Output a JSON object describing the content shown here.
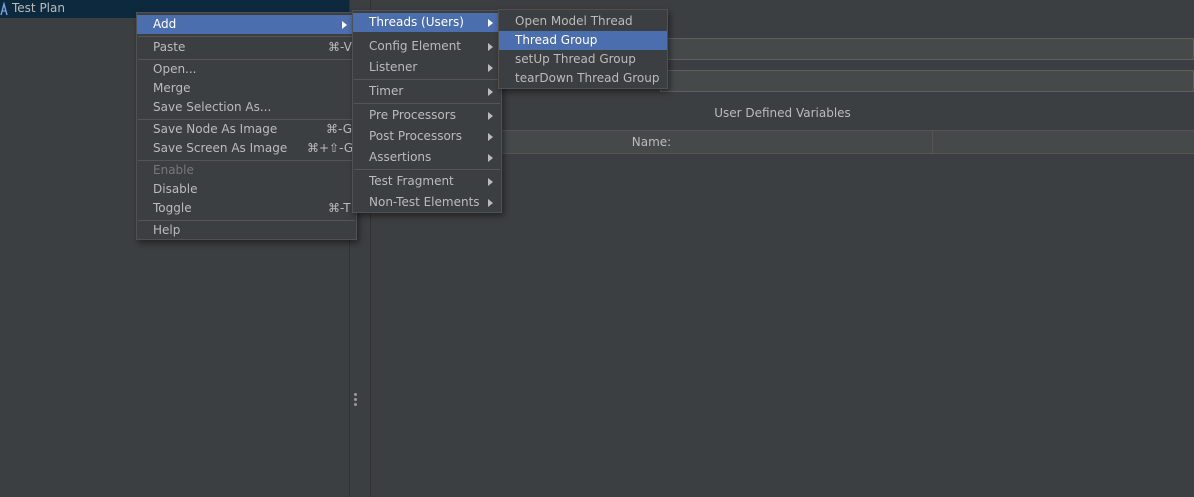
{
  "tree": {
    "root_label": "Test Plan",
    "root_icon": "test-plan-icon"
  },
  "editor": {
    "section_title": "User Defined Variables",
    "table_columns": [
      "Name:",
      ""
    ]
  },
  "context_menu": {
    "items": [
      {
        "label": "Add",
        "shortcut": "",
        "submenu": true
      },
      {
        "label": "Paste",
        "shortcut": "⌘-V"
      },
      {
        "label": "Open...",
        "shortcut": ""
      },
      {
        "label": "Merge",
        "shortcut": ""
      },
      {
        "label": "Save Selection As...",
        "shortcut": ""
      },
      {
        "label": "Save Node As Image",
        "shortcut": "⌘-G"
      },
      {
        "label": "Save Screen As Image",
        "shortcut": "⌘+⇧-G"
      },
      {
        "label": "Enable",
        "shortcut": "",
        "disabled": true
      },
      {
        "label": "Disable",
        "shortcut": ""
      },
      {
        "label": "Toggle",
        "shortcut": "⌘-T"
      },
      {
        "label": "Help",
        "shortcut": ""
      }
    ]
  },
  "add_submenu": {
    "items": [
      {
        "label": "Threads (Users)"
      },
      {
        "label": "Config Element"
      },
      {
        "label": "Listener"
      },
      {
        "label": "Timer"
      },
      {
        "label": "Pre Processors"
      },
      {
        "label": "Post Processors"
      },
      {
        "label": "Assertions"
      },
      {
        "label": "Test Fragment"
      },
      {
        "label": "Non-Test Elements"
      }
    ]
  },
  "threads_submenu": {
    "items": [
      {
        "label": "Open Model Thread Group"
      },
      {
        "label": "Thread Group"
      },
      {
        "label": "setUp Thread Group"
      },
      {
        "label": "tearDown Thread Group"
      }
    ]
  },
  "colors": {
    "background": "#3c3f41",
    "selection": "#4b6eaf",
    "tree_selection": "#0d293e",
    "text": "#bbbbbb",
    "disabled_text": "#777777"
  }
}
